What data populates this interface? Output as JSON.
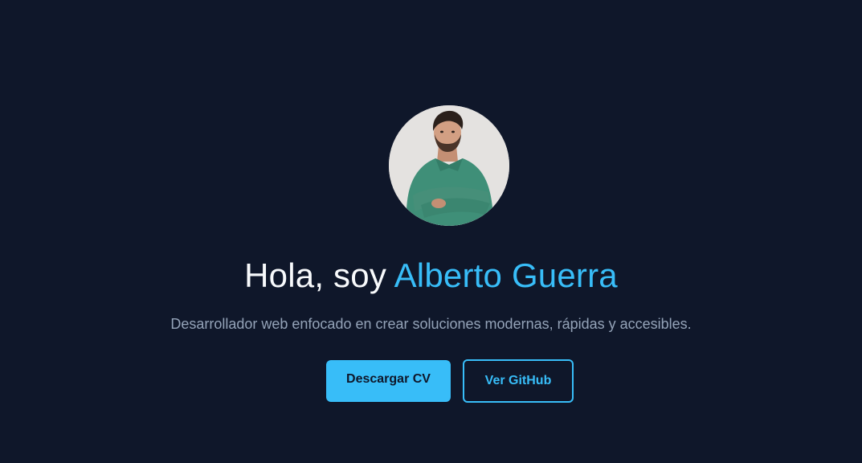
{
  "hero": {
    "avatar_alt": "Alberto Guerra",
    "greeting": "Hola, soy",
    "name": "Alberto Guerra",
    "tagline": "Desarrollador web enfocado en crear soluciones modernas, rápidas y accesibles.",
    "buttons": {
      "download_cv": "Descargar CV",
      "github": "Ver GitHub"
    }
  },
  "colors": {
    "background": "#0f172a",
    "accent": "#38bdf8",
    "text": "#f8fafc",
    "muted": "#94a3b8"
  }
}
